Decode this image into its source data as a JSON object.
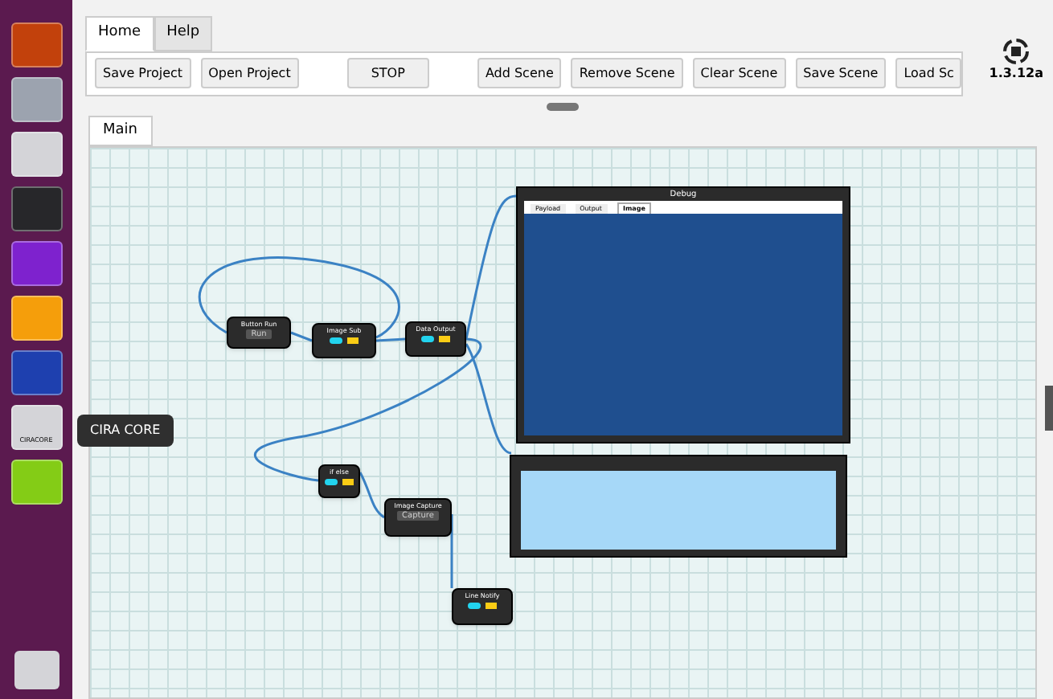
{
  "menu_tabs": [
    {
      "label": "Home",
      "selected": true
    },
    {
      "label": "Help",
      "selected": false
    }
  ],
  "toolbar": [
    "Save Project",
    "Open Project",
    "STOP",
    "Add Scene",
    "Remove Scene",
    "Clear Scene",
    "Save Scene",
    "Load Sc"
  ],
  "version": "1.3.12a",
  "launcher": {
    "app_label": "CIRACORE",
    "tooltip": "CIRA CORE"
  },
  "canvas_tabs": [
    {
      "label": "Main",
      "selected": true
    }
  ],
  "nodes": [
    {
      "title": "Button Run",
      "button": "Run"
    },
    {
      "title": "Image Sub"
    },
    {
      "title": "Data Output"
    },
    {
      "title": "if else"
    },
    {
      "title": "Image Capture",
      "button": "Capture"
    },
    {
      "title": "Line Notify"
    }
  ],
  "debug": {
    "title": "Debug",
    "tabs": [
      {
        "label": "Payload",
        "selected": false
      },
      {
        "label": "Output",
        "selected": false
      },
      {
        "label": "Image",
        "selected": true
      }
    ]
  }
}
